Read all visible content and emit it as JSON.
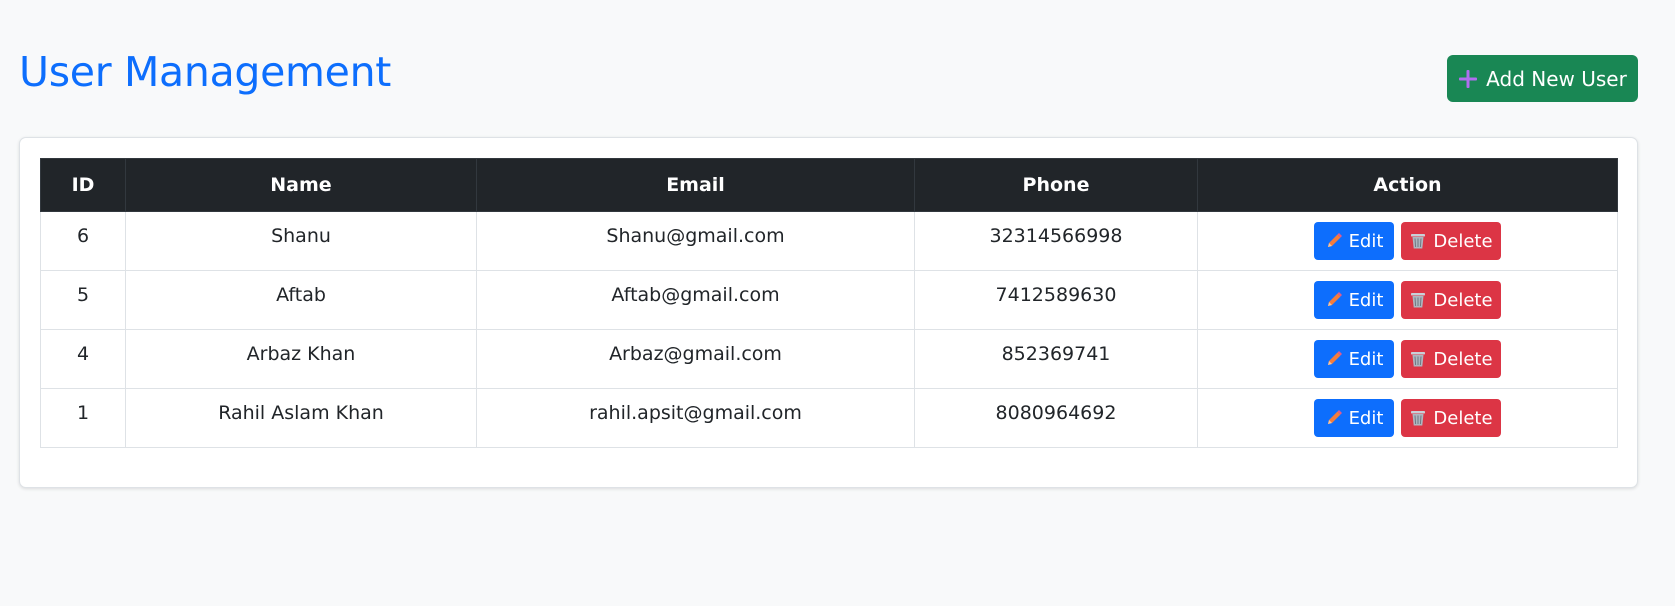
{
  "header": {
    "title": "User Management",
    "add_button_label": "Add New User"
  },
  "table": {
    "columns": [
      "ID",
      "Name",
      "Email",
      "Phone",
      "Action"
    ],
    "rows": [
      {
        "id": "6",
        "name": "Shanu",
        "email": "Shanu@gmail.com",
        "phone": "32314566998"
      },
      {
        "id": "5",
        "name": "Aftab",
        "email": "Aftab@gmail.com",
        "phone": "7412589630"
      },
      {
        "id": "4",
        "name": "Arbaz Khan",
        "email": "Arbaz@gmail.com",
        "phone": "852369741"
      },
      {
        "id": "1",
        "name": "Rahil Aslam Khan",
        "email": "rahil.apsit@gmail.com",
        "phone": "8080964692"
      }
    ],
    "edit_label": "Edit",
    "delete_label": "Delete"
  },
  "icons": {
    "add": "plus-icon",
    "edit": "pencil-icon",
    "delete": "wastebasket-icon"
  },
  "colors": {
    "title": "#0d6efd",
    "add_button": "#198754",
    "header_bg": "#212529",
    "edit_button": "#0d6efd",
    "delete_button": "#dc3545",
    "page_bg": "#f8f9fa"
  }
}
